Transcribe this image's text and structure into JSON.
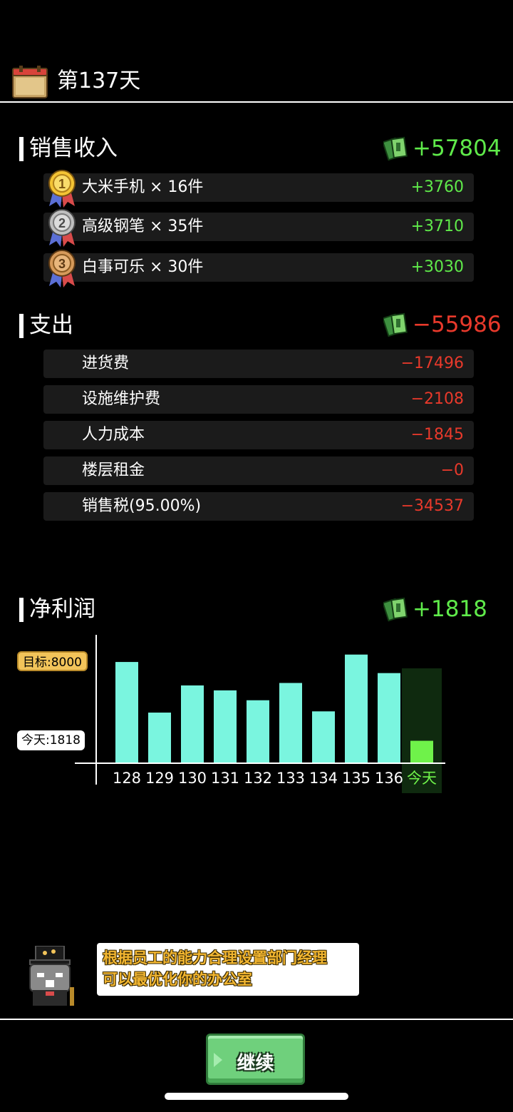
{
  "header": {
    "day_title": "第137天",
    "calendar_icon": "calendar-icon"
  },
  "income": {
    "title": "销售收入",
    "total": "+57804",
    "items": [
      {
        "rank": "1",
        "label": "大米手机 × 16件",
        "value": "+3760"
      },
      {
        "rank": "2",
        "label": "高级钢笔 × 35件",
        "value": "+3710"
      },
      {
        "rank": "3",
        "label": "白事可乐 × 30件",
        "value": "+3030"
      }
    ]
  },
  "expense": {
    "title": "支出",
    "total": "−55986",
    "items": [
      {
        "label": "进货费",
        "value": "−17496"
      },
      {
        "label": "设施维护费",
        "value": "−2108"
      },
      {
        "label": "人力成本",
        "value": "−1845"
      },
      {
        "label": "楼层租金",
        "value": "−0"
      },
      {
        "label": "销售税(95.00%)",
        "value": "−34537"
      }
    ]
  },
  "profit": {
    "title": "净利润",
    "total": "+1818",
    "target_label": "目标:8000",
    "today_label": "今天:1818"
  },
  "chart_data": {
    "type": "bar",
    "categories": [
      "128",
      "129",
      "130",
      "131",
      "132",
      "133",
      "134",
      "135",
      "136",
      "今天"
    ],
    "values": [
      8200,
      4100,
      6300,
      5900,
      5100,
      6500,
      4200,
      8800,
      7300,
      1818
    ],
    "target": 8000,
    "ylim": [
      0,
      10400
    ],
    "highlight_index": 9,
    "bar_color": "#7af5df",
    "today_color": "#6ff24a"
  },
  "tip": {
    "lines": [
      "根据员工的能力合理设置部门经理",
      "可以最优化你的办公室"
    ],
    "avatar": "cat-manager-avatar"
  },
  "continue_button": "继续",
  "colors": {
    "positive": "#5fea4a",
    "negative": "#e8392b",
    "row_bg": "#1b1b1b"
  }
}
